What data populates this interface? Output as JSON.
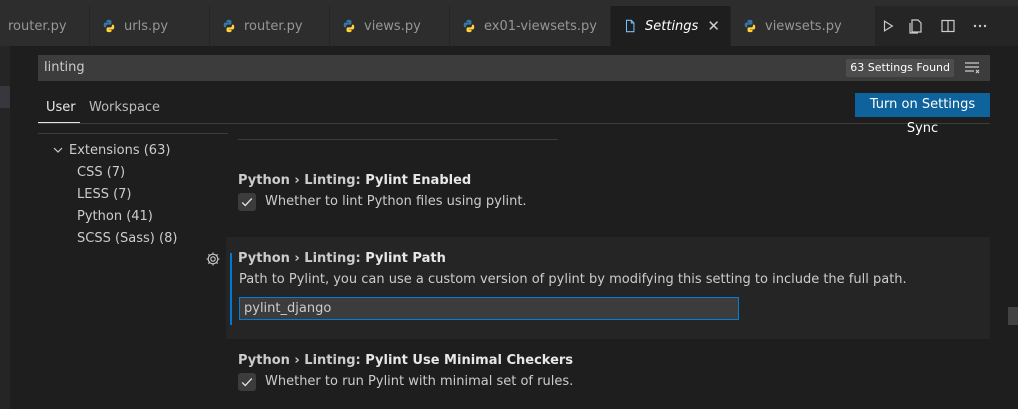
{
  "tabs": [
    {
      "label": "router.py",
      "icon": "python-icon",
      "active": false
    },
    {
      "label": "urls.py",
      "icon": "python-icon",
      "active": false
    },
    {
      "label": "router.py",
      "icon": "python-icon",
      "active": false
    },
    {
      "label": "views.py",
      "icon": "python-icon",
      "active": false
    },
    {
      "label": "ex01-viewsets.py",
      "icon": "python-icon",
      "active": false
    },
    {
      "label": "Settings",
      "icon": "settings-file-icon",
      "active": true,
      "close": "✕"
    },
    {
      "label": "viewsets.py",
      "icon": "python-icon",
      "active": false
    }
  ],
  "search": {
    "query": "linting",
    "result_count": "63 Settings Found"
  },
  "scopes": {
    "user": "User",
    "workspace": "Workspace"
  },
  "sync_button": "Turn on Settings Sync",
  "toc": {
    "root": "Extensions (63)",
    "items": [
      "CSS (7)",
      "LESS (7)",
      "Python (41)",
      "SCSS (Sass) (8)"
    ]
  },
  "settings": [
    {
      "category": "Python › Linting: ",
      "name": "Pylint Enabled",
      "description": "Whether to lint Python files using pylint.",
      "checked": true
    },
    {
      "category": "Python › Linting: ",
      "name": "Pylint Path",
      "description": "Path to Pylint, you can use a custom version of pylint by modifying this setting to include the full path.",
      "value": "pylint_django"
    },
    {
      "category": "Python › Linting: ",
      "name": "Pylint Use Minimal Checkers",
      "description": "Whether to run Pylint with minimal set of rules.",
      "checked": true
    }
  ],
  "colors": {
    "accent": "#0e639c",
    "focus": "#007fd4",
    "python_blue": "#3776ab",
    "python_yellow": "#ffd43b"
  }
}
